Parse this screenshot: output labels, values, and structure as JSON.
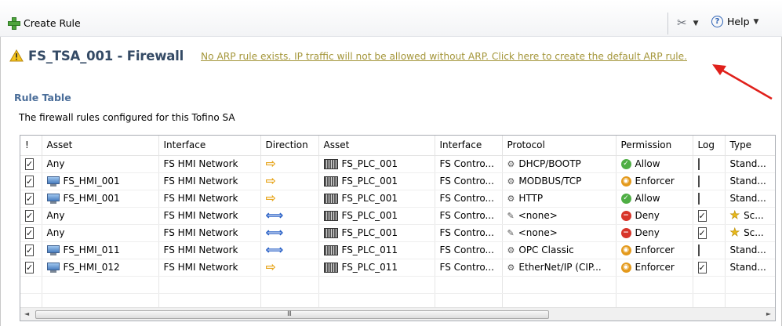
{
  "toolbar": {
    "create_rule_label": "Create Rule",
    "help_label": "Help",
    "help_glyph": "?",
    "dropdown_glyph": "▼",
    "wrench_glyph": "✂"
  },
  "header": {
    "title": "FS_TSA_001 - Firewall",
    "arp_link": "No ARP rule exists. IP traffic will not be allowed without ARP. Click here to create the default ARP rule."
  },
  "section": {
    "title": "Rule Table",
    "description": "The firewall rules configured for this Tofino SA"
  },
  "table": {
    "columns": [
      "!",
      "Asset",
      "Interface",
      "Direction",
      "Asset",
      "Interface",
      "Protocol",
      "Permission",
      "Log",
      "Type"
    ],
    "rows": [
      {
        "enabled": true,
        "src_asset": "Any",
        "src_icon": "none",
        "src_interface": "FS HMI Network",
        "direction": "right",
        "dst_asset": "FS_PLC_001",
        "dst_interface": "FS Contro...",
        "protocol": "DHCP/BOOTP",
        "permission": "Allow",
        "log": false,
        "type": "Stand...",
        "type_star": false
      },
      {
        "enabled": true,
        "src_asset": "FS_HMI_001",
        "src_icon": "monitor",
        "src_interface": "FS HMI Network",
        "direction": "right",
        "dst_asset": "FS_PLC_001",
        "dst_interface": "FS Contro...",
        "protocol": "MODBUS/TCP",
        "permission": "Enforcer",
        "log": false,
        "type": "Stand...",
        "type_star": false
      },
      {
        "enabled": true,
        "src_asset": "FS_HMI_001",
        "src_icon": "monitor",
        "src_interface": "FS HMI Network",
        "direction": "right",
        "dst_asset": "FS_PLC_001",
        "dst_interface": "FS Contro...",
        "protocol": "HTTP",
        "permission": "Allow",
        "log": false,
        "type": "Stand...",
        "type_star": false
      },
      {
        "enabled": true,
        "src_asset": "Any",
        "src_icon": "none",
        "src_interface": "FS HMI Network",
        "direction": "both",
        "dst_asset": "FS_PLC_001",
        "dst_interface": "FS Contro...",
        "protocol": "<none>",
        "permission": "Deny",
        "log": true,
        "type": "Sc...",
        "type_star": true
      },
      {
        "enabled": true,
        "src_asset": "Any",
        "src_icon": "none",
        "src_interface": "FS HMI Network",
        "direction": "both",
        "dst_asset": "FS_PLC_001",
        "dst_interface": "FS Contro...",
        "protocol": "<none>",
        "permission": "Deny",
        "log": true,
        "type": "Sc...",
        "type_star": true
      },
      {
        "enabled": true,
        "src_asset": "FS_HMI_011",
        "src_icon": "monitor",
        "src_interface": "FS HMI Network",
        "direction": "both",
        "dst_asset": "FS_PLC_011",
        "dst_interface": "FS Contro...",
        "protocol": "OPC Classic",
        "permission": "Enforcer",
        "log": false,
        "type": "Stand...",
        "type_star": false
      },
      {
        "enabled": true,
        "src_asset": "FS_HMI_012",
        "src_icon": "monitor",
        "src_interface": "FS HMI Network",
        "direction": "right",
        "dst_asset": "FS_PLC_011",
        "dst_interface": "FS Contro...",
        "protocol": "EtherNet/IP (CIP...",
        "permission": "Enforcer",
        "log": true,
        "type": "Stand...",
        "type_star": false
      }
    ]
  },
  "scrollbar": {
    "grip": "III",
    "left": "◄",
    "right": "►"
  },
  "colors": {
    "title": "#344a65",
    "link": "#a4963a",
    "section_title": "#4a6d99",
    "allow": "#4fae44",
    "deny": "#d8352a",
    "enforcer": "#e49a1c",
    "direction_right": "#e7a51c",
    "direction_both": "#2b62c7",
    "annotation_arrow": "#e0201b"
  },
  "icons": {
    "toolbar": [
      "plus-icon",
      "wrench-icon",
      "help-icon"
    ],
    "header": "warning-icon",
    "direction_right": "arrow-right-icon",
    "direction_both": "arrow-both-icon",
    "src_monitor": "monitor-icon",
    "dst_plc": "plc-icon",
    "type_star": "star-icon"
  }
}
